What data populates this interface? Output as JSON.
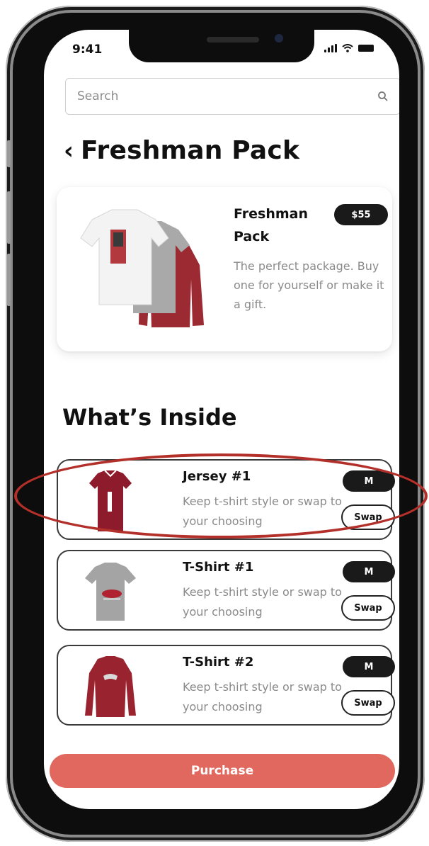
{
  "status_bar": {
    "time": "9:41"
  },
  "search": {
    "placeholder": "Search"
  },
  "header": {
    "title": "Freshman Pack"
  },
  "pack": {
    "name": "Freshman Pack",
    "price": "$55",
    "description": "The perfect package. Buy one for yourself or make it a gift."
  },
  "inside": {
    "title": "What’s Inside",
    "items": [
      {
        "name": "Jersey #1",
        "description": "Keep t-shirt style or swap to your choosing",
        "size": "M",
        "swap_label": "Swap",
        "icon": "jersey-icon"
      },
      {
        "name": "T-Shirt #1",
        "description": "Keep t-shirt style or swap to your choosing",
        "size": "M",
        "swap_label": "Swap",
        "icon": "tshirt-icon"
      },
      {
        "name": "T-Shirt #2",
        "description": "Keep t-shirt style or swap to your choosing",
        "size": "M",
        "swap_label": "Swap",
        "icon": "longsleeve-icon"
      }
    ]
  },
  "purchase": {
    "label": "Purchase"
  },
  "colors": {
    "accent": "#e0685f",
    "highlight": "#b3302a",
    "badge": "#1a1a1a",
    "jersey": "#8e1b2b"
  }
}
